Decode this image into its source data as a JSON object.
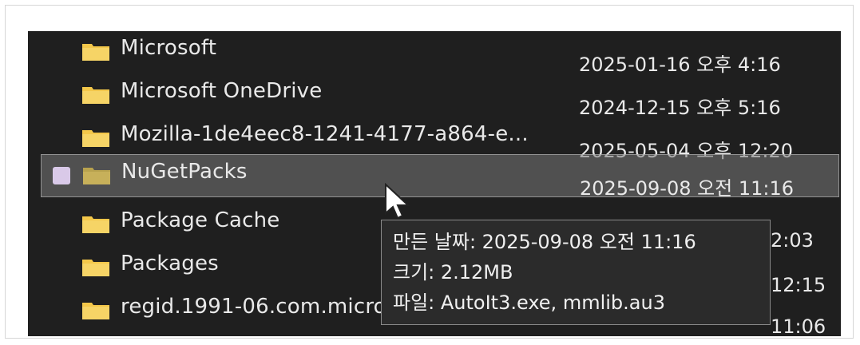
{
  "files": [
    {
      "name": "Microsoft",
      "date": "2025-01-16 오후 4:16"
    },
    {
      "name": "Microsoft OneDrive",
      "date": "2024-12-15 오후 5:16"
    },
    {
      "name": "Mozilla-1de4eec8-1241-4177-a864-e...",
      "date": "2025-05-04 오후 12:20"
    },
    {
      "name": "NuGetPacks",
      "date": "2025-09-08 오전 11:16"
    },
    {
      "name": "Package Cache",
      "date": "2:03"
    },
    {
      "name": "Packages",
      "date": "12:15"
    },
    {
      "name": "regid.1991-06.com.microsoft",
      "date": "11:06"
    }
  ],
  "tooltip": {
    "line1": "만든 날짜: 2025-09-08 오전 11:16",
    "line2": "크기: 2.12MB",
    "line3": "파일: AutoIt3.exe, mmlib.au3"
  },
  "colors": {
    "screen_bg": "#1f1f1f",
    "folder": "#f3c74a",
    "selected_bg": "#6e6e6e",
    "text": "#e9e9e9"
  }
}
